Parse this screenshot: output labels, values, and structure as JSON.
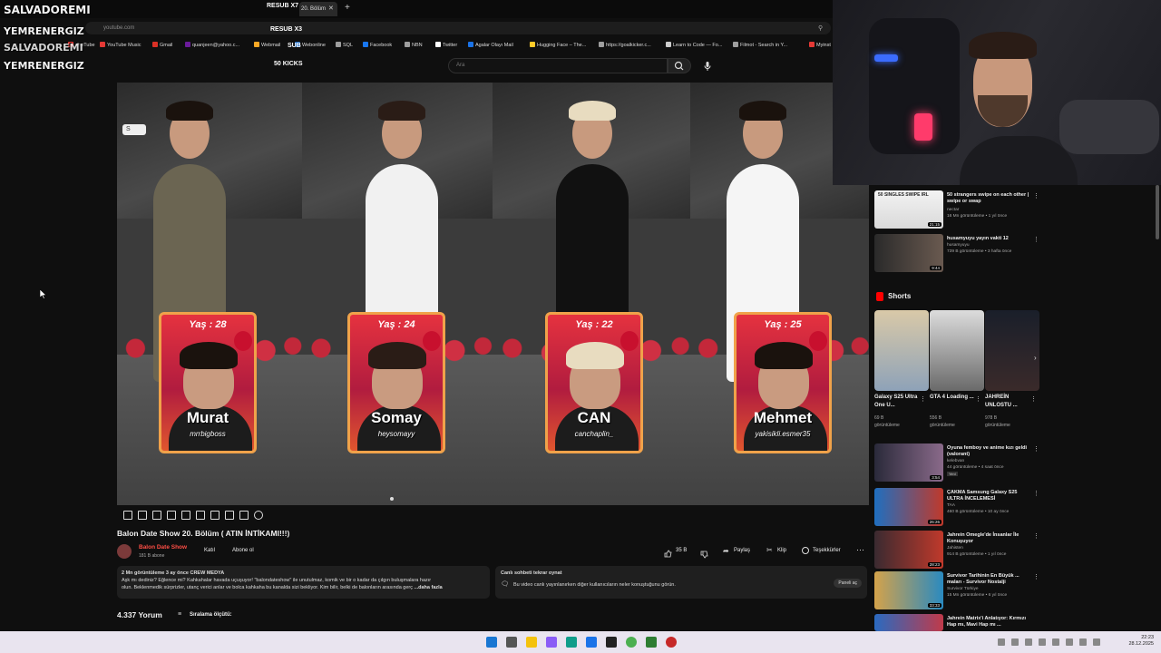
{
  "overlay": {
    "streamer": "SALVADOREMI",
    "line2": "YEMRENERGIZ",
    "line3": "SALVADOREMI",
    "line4": "YEMRENERGIZ",
    "resub1": "RESUB X7",
    "resub2": "RESUB X3",
    "sub": "SUB",
    "kicks": "50 KICKS"
  },
  "browser": {
    "tab_label": "20. Bölüm",
    "new_tab": "+",
    "close": "✕",
    "url": "youtube.com",
    "bookmarks": [
      {
        "label": "YouTube",
        "color": "#e53935"
      },
      {
        "label": "YouTube Music",
        "color": "#e53935"
      },
      {
        "label": "Gmail",
        "color": "#d93025"
      },
      {
        "label": "quanjeen@yahoo.c...",
        "color": "#6a1b9a"
      },
      {
        "label": "Webmail",
        "color": "#f9a825"
      },
      {
        "label": "Webonline",
        "color": "#1565c0"
      },
      {
        "label": "SQL",
        "color": "#9e9e9e"
      },
      {
        "label": "Facebook",
        "color": "#1877f2"
      },
      {
        "label": "NBN",
        "color": "#9e9e9e"
      },
      {
        "label": "Twitter",
        "color": "#ffffff"
      },
      {
        "label": "Agalar Olayı Mail",
        "color": "#1a73e8"
      },
      {
        "label": "Hugging Face – The...",
        "color": "#ffca28"
      },
      {
        "label": "https://goalkicker.c...",
        "color": "#9e9e9e"
      },
      {
        "label": "Learn to Code — Fo...",
        "color": "#cccccc"
      },
      {
        "label": "Filmot - Search in Y...",
        "color": "#9e9e9e"
      },
      {
        "label": "Myinst",
        "color": "#e53935"
      }
    ]
  },
  "search": {
    "placeholder": "Ara"
  },
  "video": {
    "badge": "S",
    "cards": [
      {
        "age": "Yaş : 28",
        "name": "Murat",
        "handle": "mrrbigboss"
      },
      {
        "age": "Yaş : 24",
        "name": "Somay",
        "handle": "heysomayy"
      },
      {
        "age": "Yaş : 22",
        "name": "CAN",
        "handle": "canchaplin_"
      },
      {
        "age": "Yaş : 25",
        "name": "Mehmet",
        "handle": "yakisikli.esmer35"
      }
    ]
  },
  "info": {
    "title": "Balon Date Show 20. Bölüm ( ATIN İNTİKAMI!!!)",
    "channel": "Balon Date Show",
    "subs": "181 B abone",
    "join": "Katıl",
    "subscribe": "Abone ol",
    "likes": "35 B",
    "share": "Paylaş",
    "clip": "Klip",
    "thanks": "Teşekkürler",
    "more": "⋯",
    "desc_meta": "2 Mn görüntüleme  3 ay önce  CREW MEDYA",
    "desc_line1": "Aşk mı dediniz? Eğlence mi? Kahkahalar havada uçuşuyor! \"balondateshow\" ile unutulmaz, komik ve bir o kadar da çılgın buluşmalara hazır",
    "desc_line2": "olun. Beklenmedik sürprizler, utanç verici anlar ve bolca kahkaha bu kanalda sizi bekliyor. Kim bilir, belki de balonların arasında gerç",
    "desc_more": "...daha fazla",
    "chat_title": "Canlı sohbeti tekrar oynat",
    "chat_text": "Bu video canlı yayınlanırken diğer kullanıcıların neler konuştuğunu görün.",
    "chat_btn": "Paneli aç",
    "comments": "4.337 Yorum",
    "sort": "Sıralama ölçütü:"
  },
  "sidebar": {
    "related_top": [
      {
        "title": "50 strangers swipe on each other | swipe or swap",
        "channel": "nectar",
        "meta": "16 Mn görüntüleme • 1 yıl önce",
        "duration": "21:15",
        "thumb_label": "50 SINGLES SWIPE IRL"
      },
      {
        "title": "husamyuyu yayın vakti 12",
        "channel": "husamyuyu",
        "meta": "739 B görüntüleme • 3 hafta önce",
        "duration": "9:44"
      }
    ],
    "shorts_title": "Shorts",
    "shorts": [
      {
        "title": "Galaxy S25 Ultra One U...",
        "meta1": "69 B",
        "meta2": "görüntüleme"
      },
      {
        "title": "GTA 4 Loading ...",
        "meta1": "556 B",
        "meta2": "görüntüleme"
      },
      {
        "title": "JAHREİN UNLOSTU ...",
        "meta1": "978 B",
        "meta2": "görüntüleme"
      }
    ],
    "related": [
      {
        "title": "Oyuna femboy ve anime kızı geldi (valorant)",
        "channel": "kelebvan",
        "meta": "44 görüntüleme • 4 saat önce",
        "badge": "Yeni",
        "duration": "3:54"
      },
      {
        "title": "ÇAKMA Samsung Galaxy S25 ULTRA İNCELEMESİ",
        "channel": "TAA",
        "meta": "460 B görüntüleme • 10 ay önce",
        "duration": "26:26"
      },
      {
        "title": "Jahrein Omegle'de İnsanlar İle Konuşuyor",
        "channel": "Jahisten",
        "meta": "914 B görüntüleme • 1 yıl önce",
        "duration": "28:23"
      },
      {
        "title": "Survivor Tarihinin En Büyük ... maları - Survivor Nostalji",
        "channel": "Survivor Türkiye",
        "meta": "15 Mn görüntüleme • 6 yıl önce",
        "duration": "33:33"
      },
      {
        "title": "Jahrein Matrix'i Anlatıyor: Kırmızı Hap mı, Mavi Hap mı ...",
        "channel": "",
        "meta": "",
        "duration": ""
      }
    ]
  },
  "taskbar": {
    "time": "22:23",
    "date": "28.12.2025"
  },
  "colors": {
    "accent": "#ff0000",
    "channel_red": "#ff4e45",
    "card_border": "#f0a24a"
  }
}
